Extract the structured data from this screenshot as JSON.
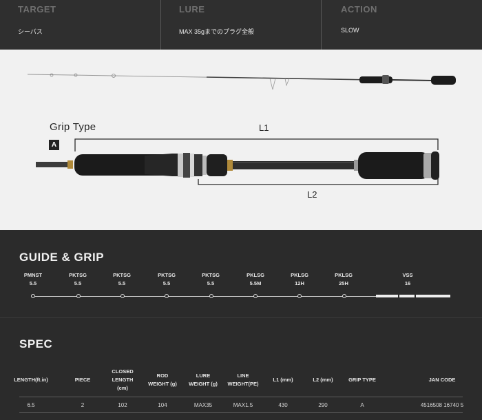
{
  "top_info": [
    {
      "label": "TARGET",
      "value": "シーバス"
    },
    {
      "label": "LURE",
      "value": "MAX 35gまでのプラグ全般"
    },
    {
      "label": "ACTION",
      "value": "SLOW"
    }
  ],
  "product_image": {
    "grip_type_title": "Grip Type",
    "grip_letter": "A",
    "l1_label": "L1",
    "l2_label": "L2"
  },
  "guide_grip": {
    "title": "GUIDE & GRIP",
    "guides": [
      {
        "name": "PMNST",
        "size": "5.5"
      },
      {
        "name": "PKTSG",
        "size": "5.5"
      },
      {
        "name": "PKTSG",
        "size": "5.5"
      },
      {
        "name": "PKTSG",
        "size": "5.5"
      },
      {
        "name": "PKTSG",
        "size": "5.5"
      },
      {
        "name": "PKLSG",
        "size": "5.5M"
      },
      {
        "name": "PKLSG",
        "size": "12H"
      },
      {
        "name": "PKLSG",
        "size": "25H"
      },
      {
        "name": "VSS",
        "size": "16"
      }
    ]
  },
  "spec": {
    "title": "SPEC",
    "headers": [
      [
        "LENGTH(ft.in)"
      ],
      [
        "PIECE"
      ],
      [
        "CLOSED",
        "LENGTH",
        "(cm)"
      ],
      [
        "ROD",
        "WEIGHT (g)"
      ],
      [
        "LURE",
        "WEIGHT (g)"
      ],
      [
        "LINE",
        "WEIGHT(PE)"
      ],
      [
        "L1 (mm)"
      ],
      [
        "L2 (mm)"
      ],
      [
        "GRIP TYPE"
      ],
      [
        "JAN CODE"
      ]
    ],
    "row": [
      "6.5",
      "2",
      "102",
      "104",
      "MAX35",
      "MAX1.5",
      "430",
      "290",
      "A",
      "4516508 16740 5"
    ]
  }
}
